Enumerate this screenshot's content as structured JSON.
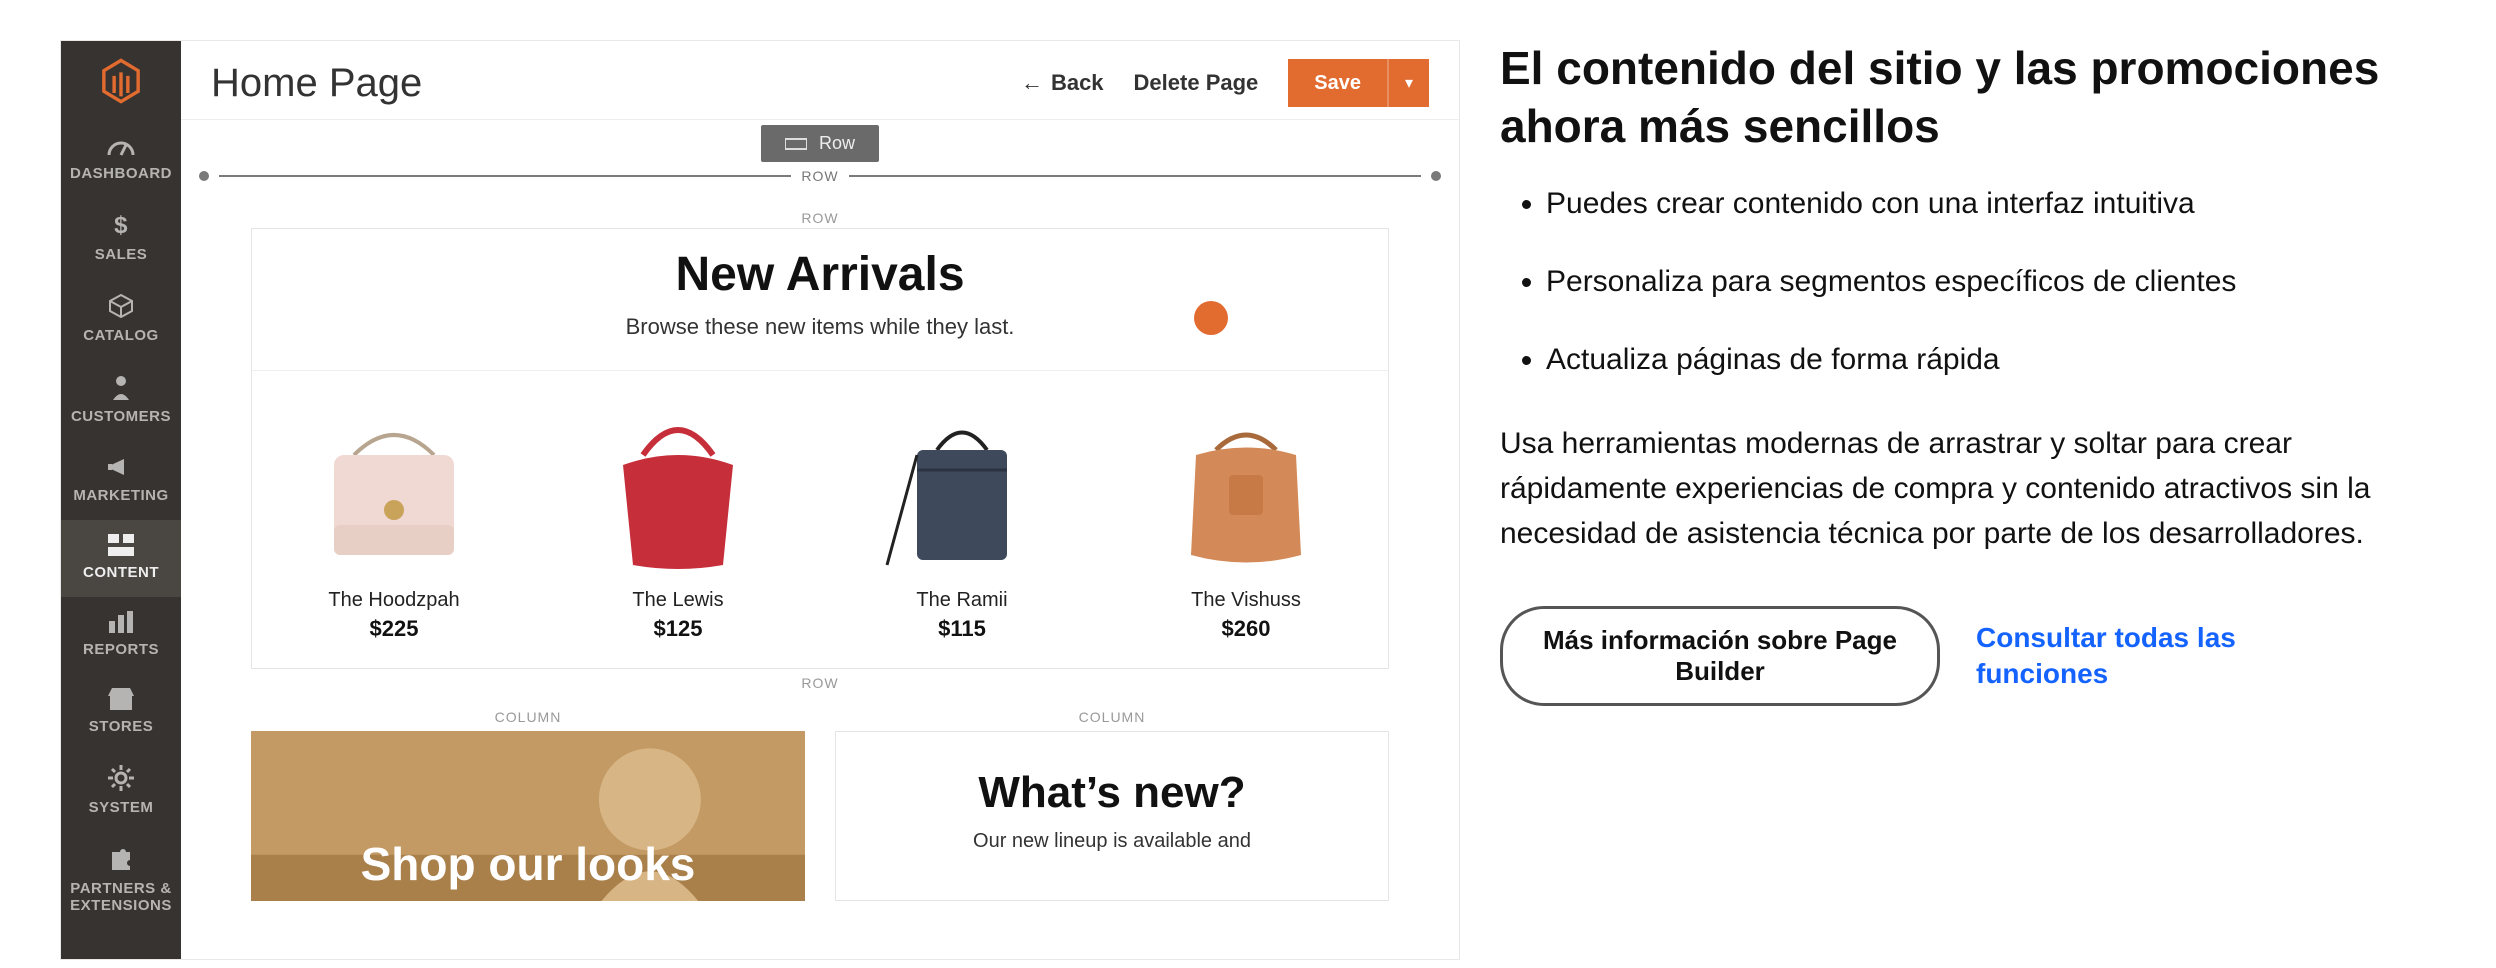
{
  "sidebar": {
    "items": [
      {
        "icon": "dashboard",
        "label": "DASHBOARD"
      },
      {
        "icon": "dollar",
        "label": "SALES"
      },
      {
        "icon": "cube",
        "label": "CATALOG"
      },
      {
        "icon": "person",
        "label": "CUSTOMERS"
      },
      {
        "icon": "bullhorn",
        "label": "MARKETING"
      },
      {
        "icon": "blocks",
        "label": "CONTENT"
      },
      {
        "icon": "bars",
        "label": "REPORTS"
      },
      {
        "icon": "store",
        "label": "STORES"
      },
      {
        "icon": "gear",
        "label": "SYSTEM"
      },
      {
        "icon": "puzzle",
        "label": "PARTNERS & EXTENSIONS"
      }
    ],
    "active_index": 5
  },
  "header": {
    "title": "Home Page",
    "back_label": "Back",
    "delete_label": "Delete Page",
    "save_label": "Save"
  },
  "drag_chip": {
    "label": "Row"
  },
  "row_divider_label": "ROW",
  "arrivals": {
    "row_label": "ROW",
    "title": "New Arrivals",
    "subtitle": "Browse these new items while they last.",
    "products": [
      {
        "name": "The Hoodzpah",
        "price": "$225",
        "color": "#efd9d2"
      },
      {
        "name": "The Lewis",
        "price": "$125",
        "color": "#c62f3a"
      },
      {
        "name": "The Ramii",
        "price": "$115",
        "color": "#3e4a5c"
      },
      {
        "name": "The Vishuss",
        "price": "$260",
        "color": "#d38a58"
      }
    ]
  },
  "columns": {
    "label": "COLUMN",
    "left": {
      "text": "Shop our looks"
    },
    "right": {
      "title": "What’s new?",
      "sub": "Our new lineup is available and"
    }
  },
  "marketing": {
    "heading": "El contenido del sitio y las promociones ahora más sencillos",
    "bullets": [
      "Puedes crear contenido con una interfaz intuitiva",
      "Personaliza para segmentos específicos de clientes",
      "Actualiza páginas de forma rápida"
    ],
    "paragraph": "Usa herramientas modernas de arrastrar y soltar para crear rápidamente experiencias de compra y contenido atractivos sin la necesidad de asistencia técnica por parte de los desarrolladores.",
    "cta_pill": "Más información sobre Page Builder",
    "cta_link": "Consultar todas las funciones"
  }
}
